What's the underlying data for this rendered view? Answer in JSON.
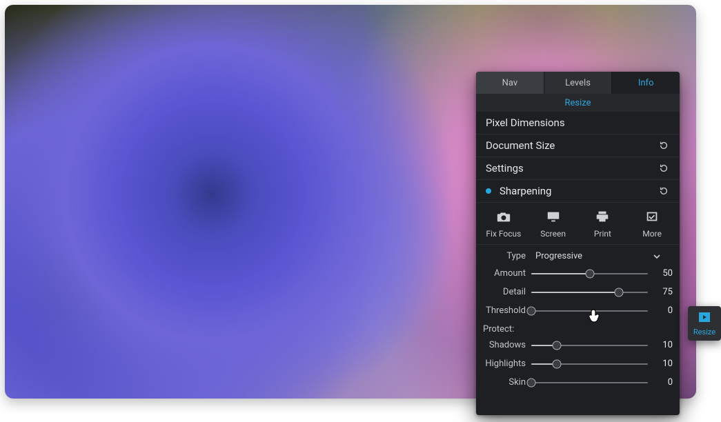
{
  "tabs": {
    "nav": "Nav",
    "levels": "Levels",
    "info": "Info"
  },
  "subheader": "Resize",
  "sections": {
    "pixel_dimensions": "Pixel Dimensions",
    "document_size": "Document Size",
    "settings": "Settings",
    "sharpening": "Sharpening"
  },
  "icons": {
    "fix_focus": "Fix Focus",
    "screen": "Screen",
    "print": "Print",
    "more": "More"
  },
  "type": {
    "label": "Type",
    "value": "Progressive"
  },
  "sliders": {
    "amount": {
      "label": "Amount",
      "value": 50,
      "pct": 50
    },
    "detail": {
      "label": "Detail",
      "value": 75,
      "pct": 75
    },
    "threshold": {
      "label": "Threshold",
      "value": 0,
      "pct": 0
    },
    "shadows": {
      "label": "Shadows",
      "value": 10,
      "pct": 22
    },
    "highlights": {
      "label": "Highlights",
      "value": 10,
      "pct": 22
    },
    "skin": {
      "label": "Skin",
      "value": 0,
      "pct": 0
    }
  },
  "protect_label": "Protect:",
  "floating_label": "Resize",
  "colors": {
    "accent": "#2aa6df",
    "panel_bg": "#1e1f22"
  }
}
